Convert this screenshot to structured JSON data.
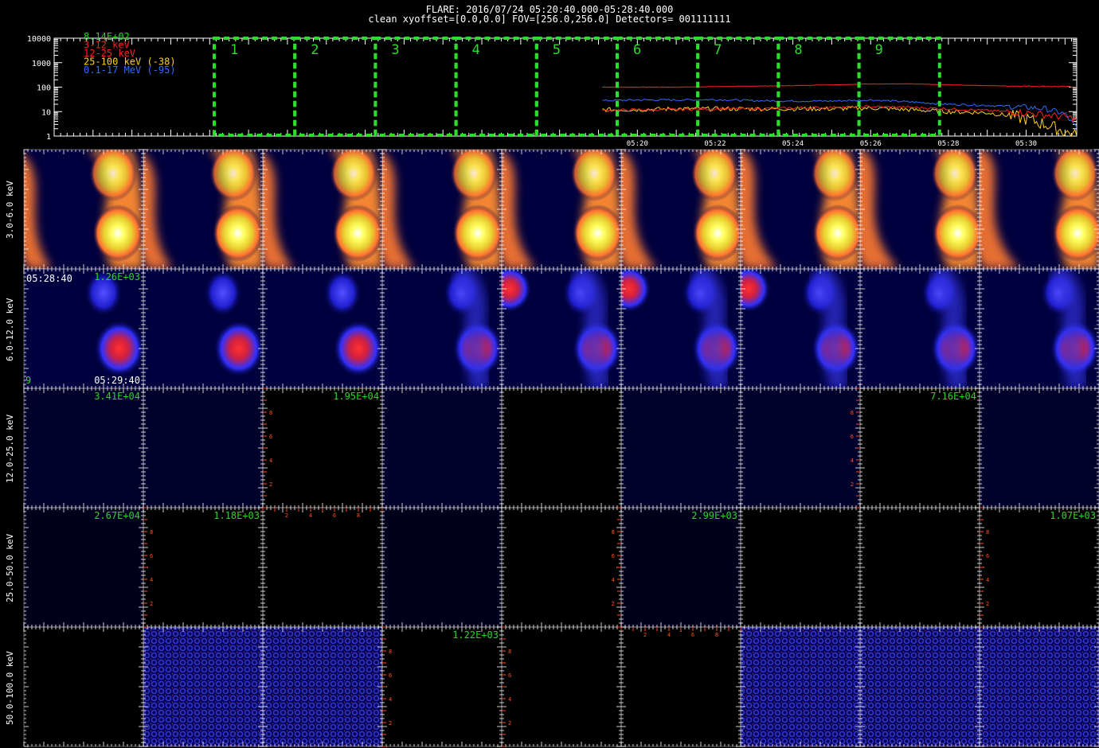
{
  "header": {
    "title": "FLARE: 2016/07/24 05:20:40.000-05:28:40.000",
    "subtitle": "clean   xyoffset=[0.0,0.0]   FOV=[256.0,256.0]   Detectors= 001111111"
  },
  "colors": {
    "c_3_12": "#ff2020",
    "c_12_25": "#ff2020",
    "c_25_100": "#ffd21e",
    "c_01_17": "#2f6cff",
    "peak": "#27d627",
    "box": "#2ddc2d",
    "axis_orange": "#ff5020"
  },
  "chart_data": [
    {
      "type": "line",
      "title": "",
      "ylabel": "",
      "xlabel": "",
      "yscale": "log",
      "ylim": [
        1,
        10000
      ],
      "ytick_labels": [
        "10000",
        "1000",
        "100",
        "10",
        "1"
      ],
      "x_range_minutes": [
        5.0,
        31.3
      ],
      "x_tick_labels": [
        "05:20",
        "05:22",
        "05:24",
        "05:26",
        "05:28",
        "05:30"
      ],
      "legend": [
        "8.14E+02",
        "3-12 keV",
        "12-25 keV",
        "25-100 keV (-38)",
        "0.1-17 MeV (-95)"
      ],
      "legend_position": "top-left",
      "box_labels": [
        "1",
        "2",
        "3",
        "4",
        "5",
        "6",
        "7",
        "8",
        "9"
      ],
      "series": [
        {
          "name": "3-12 keV",
          "x": [
            19.1,
            20.0,
            21.0,
            22.0,
            23.0,
            24.0,
            25.0,
            26.0,
            27.0,
            28.0,
            29.0,
            30.0,
            31.0,
            31.3
          ],
          "values": [
            100,
            100,
            100,
            105,
            110,
            115,
            125,
            135,
            135,
            125,
            115,
            110,
            105,
            100
          ]
        },
        {
          "name": "0.1-17 MeV (-95)",
          "x": [
            19.1,
            20.0,
            21.0,
            22.0,
            23.0,
            24.0,
            25.0,
            26.0,
            27.0,
            28.0,
            29.0,
            30.0,
            30.5,
            31.0,
            31.3
          ],
          "values": [
            28,
            30,
            30,
            31,
            28,
            27,
            27,
            30,
            25,
            20,
            18,
            15,
            13,
            8,
            2
          ]
        },
        {
          "name": "25-100 keV (-38)",
          "x": [
            19.1,
            20.0,
            21.0,
            22.0,
            23.0,
            24.0,
            25.0,
            26.0,
            27.0,
            28.0,
            29.0,
            29.5,
            30.0,
            30.5,
            31.0,
            31.3
          ],
          "values": [
            12,
            12,
            13,
            13,
            13,
            13,
            13,
            14,
            12,
            10,
            9,
            7,
            5,
            3,
            1.5,
            1
          ]
        },
        {
          "name": "12-25 keV",
          "x": [
            19.1,
            20.0,
            21.0,
            22.0,
            23.0,
            24.0,
            25.0,
            26.0,
            27.0,
            28.0,
            29.0,
            30.0,
            31.0,
            31.3
          ],
          "values": [
            11,
            12,
            12,
            13,
            13,
            14,
            15,
            16,
            15,
            13,
            11,
            9,
            6,
            5
          ]
        }
      ]
    },
    {
      "type": "heatmap",
      "row_labels": [
        "3.0-6.0 keV",
        "6.0-12.0 keV",
        "12.0-25.0 keV",
        "25.0-50.0 keV",
        "50.0-100.0 keV"
      ],
      "columns": 9,
      "panel_annotations": [
        {
          "row": 1,
          "col": 0,
          "text": "05:28:40",
          "pos": "tl",
          "color": "#ffffff"
        },
        {
          "row": 1,
          "col": 0,
          "text": "1.26E+03",
          "pos": "tr",
          "color": "#27d627"
        },
        {
          "row": 1,
          "col": 0,
          "text": "05:29:40",
          "pos": "br",
          "color": "#ffffff"
        },
        {
          "row": 1,
          "col": 0,
          "text": "9",
          "pos": "bl",
          "color": "#27d627"
        },
        {
          "row": 2,
          "col": 0,
          "text": "3.41E+04",
          "pos": "tr",
          "color": "#27d627"
        },
        {
          "row": 2,
          "col": 2,
          "text": "1.95E+04",
          "pos": "tr",
          "color": "#27d627"
        },
        {
          "row": 2,
          "col": 7,
          "text": "7.16E+04",
          "pos": "tr",
          "color": "#27d627"
        },
        {
          "row": 3,
          "col": 0,
          "text": "2.67E+04",
          "pos": "tr",
          "color": "#27d627"
        },
        {
          "row": 3,
          "col": 1,
          "text": "1.18E+03",
          "pos": "tr",
          "color": "#27d627"
        },
        {
          "row": 3,
          "col": 5,
          "text": "2.99E+03",
          "pos": "tr",
          "color": "#27d627"
        },
        {
          "row": 3,
          "col": 8,
          "text": "1.07E+03",
          "pos": "tr",
          "color": "#27d627"
        },
        {
          "row": 4,
          "col": 3,
          "text": "1.22E+03",
          "pos": "tr",
          "color": "#27d627"
        }
      ],
      "orange_axis_tick_labels": [
        "2",
        "4",
        "6",
        "8"
      ],
      "orange_axes": [
        {
          "row": 2,
          "col": 2,
          "side": "left"
        },
        {
          "row": 2,
          "col": 6,
          "side": "right"
        },
        {
          "row": 3,
          "col": 1,
          "side": "left"
        },
        {
          "row": 3,
          "col": 2,
          "side": "top"
        },
        {
          "row": 3,
          "col": 4,
          "side": "right"
        },
        {
          "row": 3,
          "col": 8,
          "side": "left"
        },
        {
          "row": 4,
          "col": 3,
          "side": "left"
        },
        {
          "row": 4,
          "col": 4,
          "side": "left"
        },
        {
          "row": 4,
          "col": 5,
          "side": "top"
        }
      ]
    }
  ]
}
